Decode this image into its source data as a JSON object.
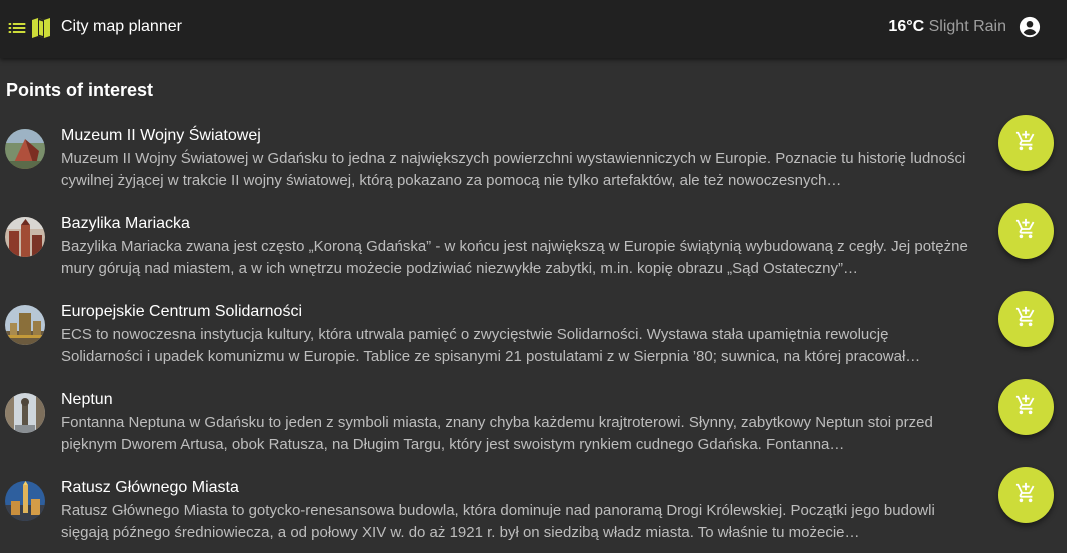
{
  "header": {
    "menu_icon": "list-icon",
    "map_icon": "map-icon",
    "title": "City map planner",
    "weather": {
      "temperature": "16°C",
      "condition": "Slight Rain"
    },
    "account_icon": "account-circle-icon"
  },
  "section": {
    "title": "Points of interest"
  },
  "items": [
    {
      "title": "Muzeum II Wojny Światowej",
      "description": "Muzeum II Wojny Światowej w Gdańsku to jedna z największych powierzchni wystawienniczych w Europie. Poznacie tu historię ludności cywilnej żyjącej w trakcie II wojny światowej, którą pokazano za pomocą nie tylko artefaktów, ale też nowoczesnych…",
      "button_icon": "add-to-cart-icon"
    },
    {
      "title": "Bazylika Mariacka",
      "description": "Bazylika Mariacka zwana jest często „Koroną Gdańska” - w końcu jest największą w Europie świątynią wybudowaną z cegły. Jej potężne mury górują nad miastem, a w ich wnętrzu możecie podziwiać niezwykłe zabytki, m.in. kopię obrazu „Sąd Ostateczny”…",
      "button_icon": "add-to-cart-icon"
    },
    {
      "title": "Europejskie Centrum Solidarności",
      "description": "ECS to nowoczesna instytucja kultury, która utrwala pamięć o zwycięstwie Solidarności. Wystawa stała upamiętnia rewolucję Solidarności i upadek komunizmu w Europie. Tablice ze spisanymi 21 postulatami z w Sierpnia ’80; suwnica, na której pracował…",
      "button_icon": "add-to-cart-icon"
    },
    {
      "title": "Neptun",
      "description": "Fontanna Neptuna w Gdańsku to jeden z symboli miasta, znany chyba każdemu krajtroterowi. Słynny, zabytkowy Neptun stoi przed pięknym Dworem Artusa, obok Ratusza, na Długim Targu, który jest swoistym rynkiem cudnego Gdańska. Fontanna…",
      "button_icon": "add-to-cart-icon"
    },
    {
      "title": "Ratusz Głównego Miasta",
      "description": "Ratusz Głównego Miasta to gotycko-renesansowa budowla, która dominuje nad panoramą Drogi Królewskiej. Początki jego budowli sięgają późnego średniowiecza, a od połowy XIV w. do aż 1921 r. był on siedzibą władz miasta. To właśnie tu możecie…",
      "button_icon": "add-to-cart-icon"
    }
  ],
  "colors": {
    "accent": "#cddc39",
    "background": "#303030",
    "toolbar": "#212121"
  }
}
